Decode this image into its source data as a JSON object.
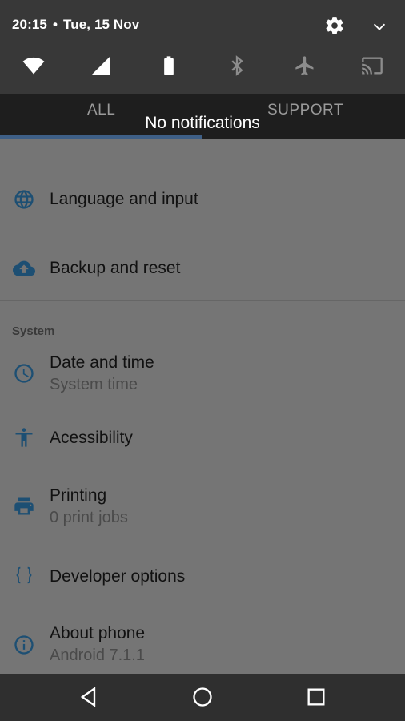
{
  "status_bar": {
    "time": "20:15",
    "separator": "•",
    "date": "Tue, 15 Nov"
  },
  "quick_settings": [
    {
      "icon": "wifi-icon",
      "state": "on"
    },
    {
      "icon": "cellular-signal-icon",
      "state": "on"
    },
    {
      "icon": "battery-icon",
      "state": "on"
    },
    {
      "icon": "bluetooth-icon",
      "state": "off"
    },
    {
      "icon": "airplane-mode-icon",
      "state": "off"
    },
    {
      "icon": "cast-icon",
      "state": "off"
    }
  ],
  "notification_shade": {
    "tabs": [
      "ALL",
      "SUPPORT"
    ],
    "empty_message": "No notifications"
  },
  "settings": {
    "items_top": [
      {
        "icon": "globe-icon",
        "title": "Language and input"
      },
      {
        "icon": "cloud-upload-icon",
        "title": "Backup and reset"
      }
    ],
    "section_title": "System",
    "items_system": [
      {
        "icon": "clock-icon",
        "title": "Date and time",
        "subtitle": "System time"
      },
      {
        "icon": "accessibility-icon",
        "title": "Acessibility"
      },
      {
        "icon": "printer-icon",
        "title": "Printing",
        "subtitle": "0 print jobs"
      },
      {
        "icon": "braces-icon",
        "title": "Developer options"
      },
      {
        "icon": "info-icon",
        "title": "About phone",
        "subtitle": "Android 7.1.1"
      }
    ]
  },
  "colors": {
    "accent_icon": "#1d4f73",
    "shade_bg": "#383838",
    "tab_bar_bg": "#1e1e1e",
    "tab_indicator": "#3e5f86",
    "screen_bg": "#757575",
    "nav_bar_bg": "#2f2f2f"
  },
  "nav_bar": [
    "back-icon",
    "home-icon",
    "recents-icon"
  ]
}
